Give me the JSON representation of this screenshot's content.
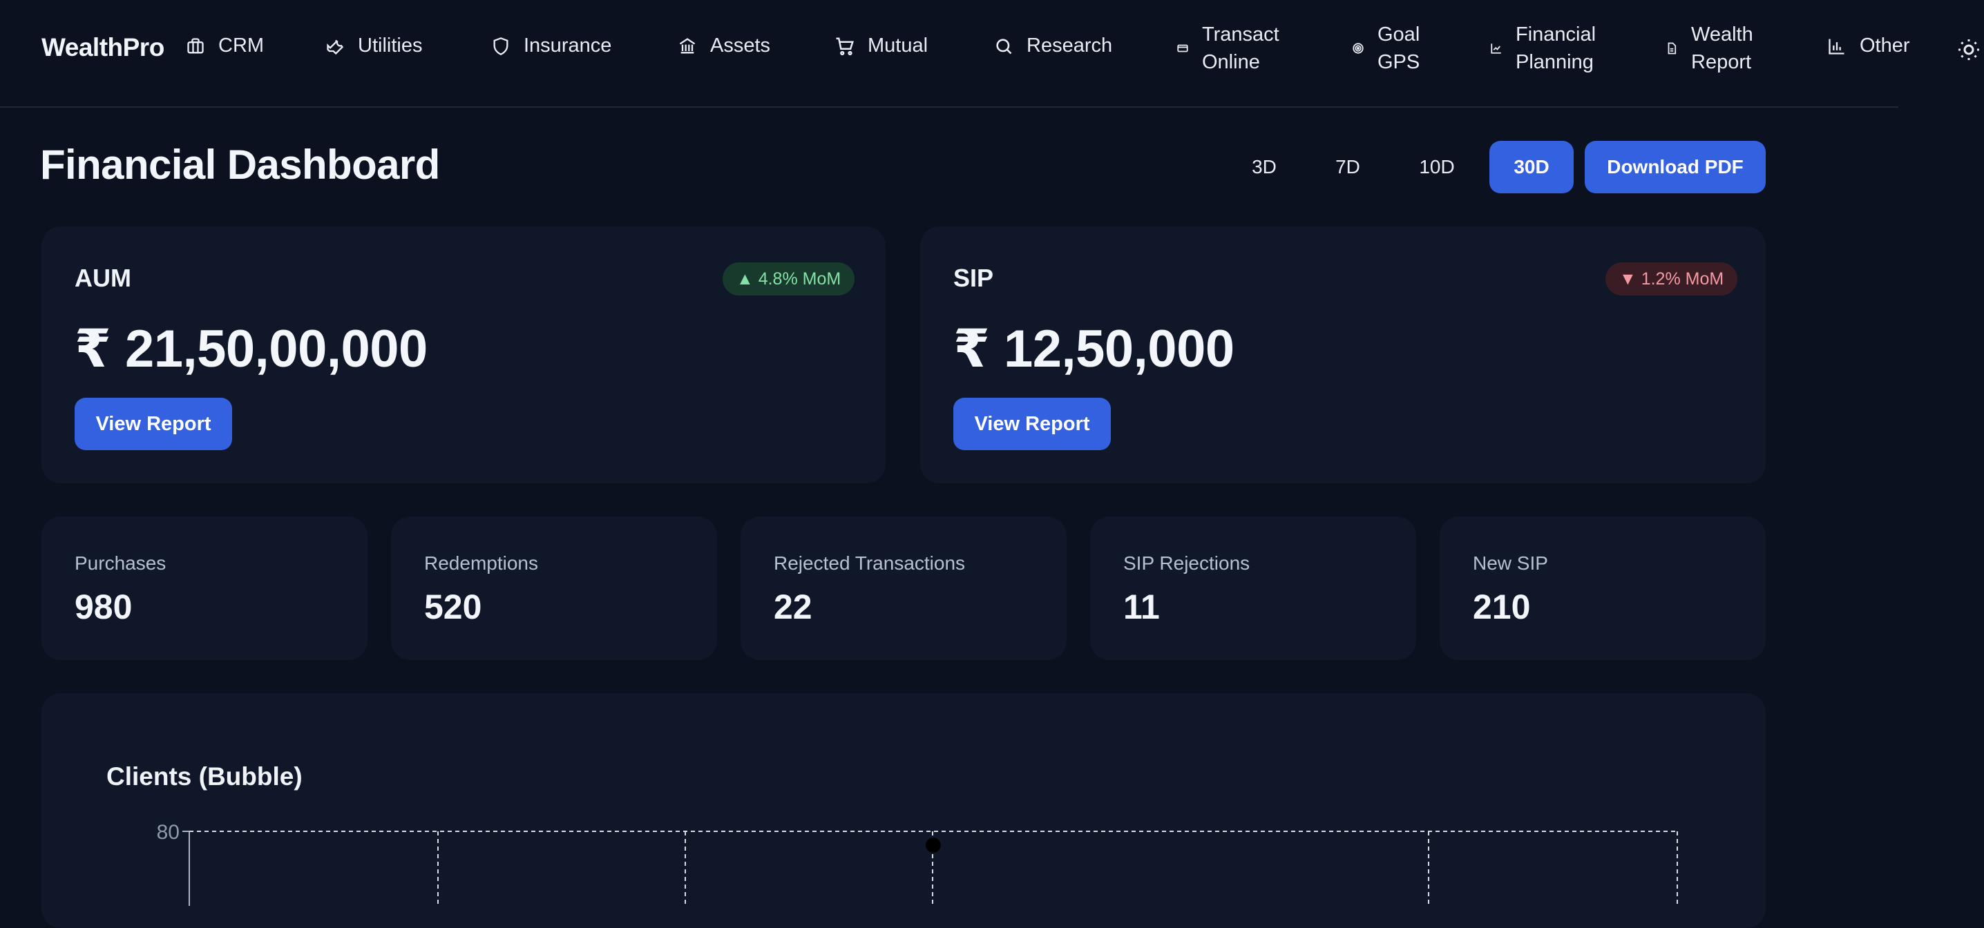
{
  "brand": "WealthPro",
  "nav": [
    {
      "label": "CRM",
      "icon": "briefcase-icon"
    },
    {
      "label": "Utilities",
      "icon": "wrench-icon"
    },
    {
      "label": "Insurance",
      "icon": "shield-icon"
    },
    {
      "label": "Assets",
      "icon": "bank-icon"
    },
    {
      "label": "Mutual",
      "icon": "cart-icon"
    },
    {
      "label": "Research",
      "icon": "search-icon"
    },
    {
      "label_line1": "Transact",
      "label_line2": "Online",
      "icon": "card-icon"
    },
    {
      "label_line1": "Goal",
      "label_line2": "GPS",
      "icon": "target-icon"
    },
    {
      "label_line1": "Financial",
      "label_line2": "Planning",
      "icon": "line-chart-icon"
    },
    {
      "label_line1": "Wealth",
      "label_line2": "Report",
      "icon": "document-icon"
    },
    {
      "label": "Other",
      "icon": "bar-chart-icon"
    }
  ],
  "theme_toggle_icon": "sun-icon",
  "page_title": "Financial Dashboard",
  "ranges": [
    "3D",
    "7D",
    "10D",
    "30D"
  ],
  "active_range": "30D",
  "download_label": "Download PDF",
  "cards": {
    "aum": {
      "title": "AUM",
      "value": "₹ 21,50,00,000",
      "badge": "▲ 4.8% MoM",
      "trend": "up",
      "button": "View Report"
    },
    "sip": {
      "title": "SIP",
      "value": "₹ 12,50,000",
      "badge": "▼ 1.2% MoM",
      "trend": "down",
      "button": "View Report"
    }
  },
  "stats": [
    {
      "label": "Purchases",
      "value": "980"
    },
    {
      "label": "Redemptions",
      "value": "520"
    },
    {
      "label": "Rejected Transactions",
      "value": "22"
    },
    {
      "label": "SIP Rejections",
      "value": "11"
    },
    {
      "label": "New SIP",
      "value": "210"
    }
  ],
  "colors": {
    "background": "#0b111e",
    "card": "#101729",
    "accent": "#3461e0",
    "up": "#84e0a5",
    "down": "#f59aa3"
  },
  "chart_data": {
    "type": "scatter",
    "title": "Clients (Bubble)",
    "y_tick_labels": [
      "80"
    ],
    "grid": true,
    "grid_style": "dashed",
    "points": [
      {
        "y": 76
      }
    ]
  }
}
